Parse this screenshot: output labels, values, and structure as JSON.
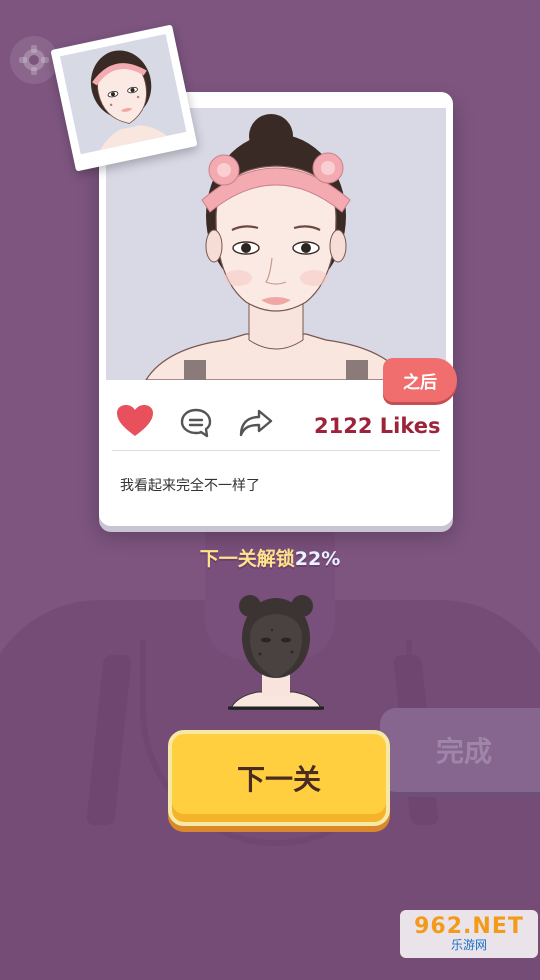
{
  "post": {
    "after_label": "之后",
    "likes_text": "2122 Likes",
    "caption": "我看起来完全不一样了"
  },
  "unlock": {
    "label": "下一关解锁",
    "percent": "22%",
    "progress": 0.22
  },
  "buttons": {
    "next": "下一关",
    "done": "完成"
  },
  "watermark": {
    "logo": "962.NET",
    "sub": "乐游网"
  },
  "icons": [
    "gear-icon",
    "heart-icon",
    "comment-icon",
    "share-icon"
  ],
  "colors": {
    "background": "#7d557f",
    "like_heart": "#e8505b",
    "likes_text": "#9c2339",
    "after_tag": "#f06e6e",
    "next_button": "#ffcf3f",
    "done_button": "#86658f"
  }
}
